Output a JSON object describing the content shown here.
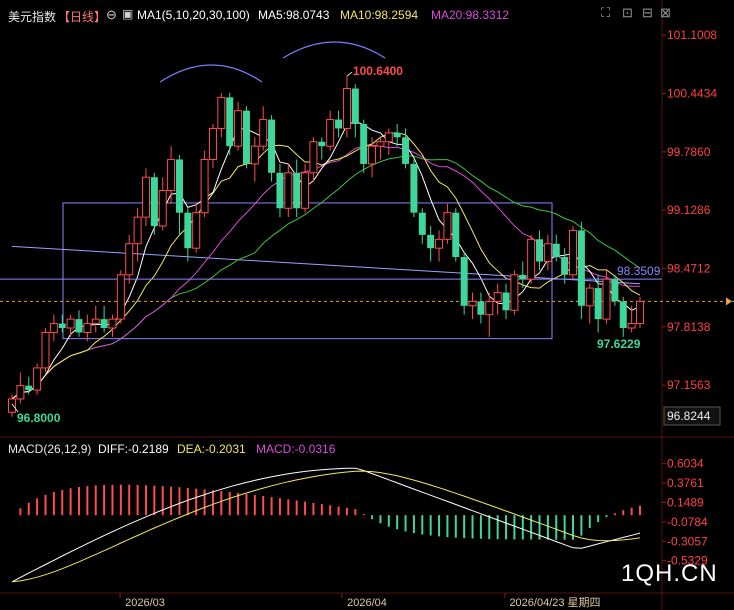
{
  "header": {
    "title": "美元指数",
    "period": "【日线】",
    "ma_label": "MA1(5,10,20,30,100)",
    "ma5": "MA5:98.0743",
    "ma10": "MA10:98.2594",
    "ma20": "MA20:98.3312"
  },
  "macd_header": {
    "params": "MACD(26,12,9)",
    "diff": "DIFF:-0.2189",
    "dea": "DEA:-0.2031",
    "macd": "MACD:-0.0316"
  },
  "watermark": "1QH.CN",
  "colors": {
    "up": "#ff4d4d",
    "down": "#3ed69a",
    "ma5": "#ffffff",
    "ma10": "#f2e85c",
    "ma20": "#d94bd9",
    "ma30": "#3fc43f",
    "ma100": "#9aa0ff",
    "axis_text": "#ff4040"
  },
  "chart_data": [
    {
      "type": "candlestick",
      "title": "美元指数 日线",
      "ylim": [
        96.65,
        101.25
      ],
      "y_ticks": [
        "101.1008",
        "100.4434",
        "99.7860",
        "99.1286",
        "98.4712",
        "97.8138",
        "97.1563"
      ],
      "current_price_label": "96.8244",
      "x_ticks": [
        "2026/03",
        "2026/04",
        "2026/04/23 星期四"
      ],
      "annotations": {
        "high": "100.6400",
        "low": "96.8000",
        "recent_low": "97.6229",
        "hline": "98.3509"
      },
      "ohlc": [
        [
          96.85,
          97.05,
          96.8,
          97.0
        ],
        [
          97.0,
          97.3,
          96.95,
          97.15
        ],
        [
          97.15,
          97.25,
          97.05,
          97.1
        ],
        [
          97.1,
          97.4,
          97.05,
          97.35
        ],
        [
          97.35,
          97.8,
          97.3,
          97.75
        ],
        [
          97.75,
          97.95,
          97.65,
          97.85
        ],
        [
          97.85,
          97.95,
          97.75,
          97.8
        ],
        [
          97.8,
          97.95,
          97.7,
          97.9
        ],
        [
          97.9,
          98.0,
          97.7,
          97.75
        ],
        [
          97.75,
          97.95,
          97.65,
          97.85
        ],
        [
          97.85,
          98.05,
          97.75,
          97.9
        ],
        [
          97.9,
          98.05,
          97.75,
          97.8
        ],
        [
          97.8,
          97.95,
          97.7,
          97.9
        ],
        [
          97.9,
          98.45,
          97.85,
          98.4
        ],
        [
          98.4,
          98.85,
          98.3,
          98.75
        ],
        [
          98.75,
          99.15,
          98.55,
          99.05
        ],
        [
          99.05,
          99.6,
          98.95,
          99.5
        ],
        [
          99.5,
          99.55,
          98.85,
          98.95
        ],
        [
          98.95,
          99.5,
          98.9,
          99.35
        ],
        [
          99.35,
          99.85,
          99.2,
          99.7
        ],
        [
          99.7,
          99.75,
          98.85,
          99.1
        ],
        [
          99.1,
          99.15,
          98.55,
          98.7
        ],
        [
          98.7,
          99.2,
          98.65,
          99.1
        ],
        [
          99.1,
          99.8,
          99.05,
          99.7
        ],
        [
          99.7,
          100.1,
          99.6,
          100.05
        ],
        [
          100.05,
          100.45,
          99.95,
          100.4
        ],
        [
          100.4,
          100.45,
          99.75,
          99.85
        ],
        [
          99.85,
          100.35,
          99.8,
          100.25
        ],
        [
          100.25,
          100.3,
          99.6,
          99.65
        ],
        [
          99.65,
          99.95,
          99.45,
          99.85
        ],
        [
          99.85,
          100.3,
          99.8,
          100.15
        ],
        [
          100.15,
          100.2,
          99.45,
          99.55
        ],
        [
          99.55,
          99.65,
          99.05,
          99.15
        ],
        [
          99.15,
          99.65,
          99.05,
          99.55
        ],
        [
          99.55,
          99.7,
          99.05,
          99.15
        ],
        [
          99.15,
          99.65,
          99.1,
          99.55
        ],
        [
          99.55,
          99.95,
          99.45,
          99.9
        ],
        [
          99.9,
          99.95,
          99.7,
          99.85
        ],
        [
          99.85,
          100.25,
          99.8,
          100.15
        ],
        [
          100.15,
          100.25,
          99.95,
          100.05
        ],
        [
          100.05,
          100.64,
          99.95,
          100.5
        ],
        [
          100.5,
          100.55,
          99.95,
          100.1
        ],
        [
          100.1,
          100.15,
          99.55,
          99.65
        ],
        [
          99.65,
          99.95,
          99.5,
          99.85
        ],
        [
          99.85,
          99.95,
          99.7,
          99.9
        ],
        [
          99.9,
          100.05,
          99.75,
          100.0
        ],
        [
          100.0,
          100.1,
          99.85,
          99.95
        ],
        [
          99.95,
          100.05,
          99.6,
          99.65
        ],
        [
          99.65,
          99.7,
          99.05,
          99.1
        ],
        [
          99.1,
          99.15,
          98.75,
          98.85
        ],
        [
          98.85,
          98.95,
          98.55,
          98.7
        ],
        [
          98.7,
          98.9,
          98.55,
          98.8
        ],
        [
          98.8,
          99.2,
          98.75,
          99.1
        ],
        [
          99.1,
          99.15,
          98.55,
          98.6
        ],
        [
          98.6,
          98.65,
          97.95,
          98.05
        ],
        [
          98.05,
          98.2,
          97.9,
          98.1
        ],
        [
          98.1,
          98.2,
          97.85,
          97.95
        ],
        [
          97.95,
          98.2,
          97.7,
          98.1
        ],
        [
          98.1,
          98.3,
          97.95,
          98.2
        ],
        [
          98.2,
          98.3,
          97.9,
          98.0
        ],
        [
          98.0,
          98.45,
          97.95,
          98.4
        ],
        [
          98.4,
          98.55,
          98.25,
          98.35
        ],
        [
          98.35,
          98.85,
          98.3,
          98.8
        ],
        [
          98.8,
          98.9,
          98.45,
          98.55
        ],
        [
          98.55,
          98.85,
          98.45,
          98.75
        ],
        [
          98.75,
          98.85,
          98.55,
          98.6
        ],
        [
          98.6,
          98.7,
          98.3,
          98.4
        ],
        [
          98.4,
          98.95,
          98.35,
          98.9
        ],
        [
          98.9,
          99.0,
          97.9,
          98.05
        ],
        [
          98.05,
          98.3,
          97.85,
          98.25
        ],
        [
          98.25,
          98.4,
          97.75,
          97.9
        ],
        [
          97.9,
          98.45,
          97.85,
          98.35
        ],
        [
          98.35,
          98.4,
          98.05,
          98.1
        ],
        [
          98.1,
          98.15,
          97.7,
          97.8
        ],
        [
          97.8,
          98.05,
          97.75,
          97.85
        ],
        [
          97.85,
          98.15,
          97.8,
          98.1
        ]
      ],
      "macd": {
        "ylim": [
          -0.9,
          0.74
        ],
        "y_ticks": [
          "0.6034",
          "0.3761",
          "0.1489",
          "-0.0784",
          "-0.3057",
          "-0.5329"
        ]
      }
    }
  ]
}
